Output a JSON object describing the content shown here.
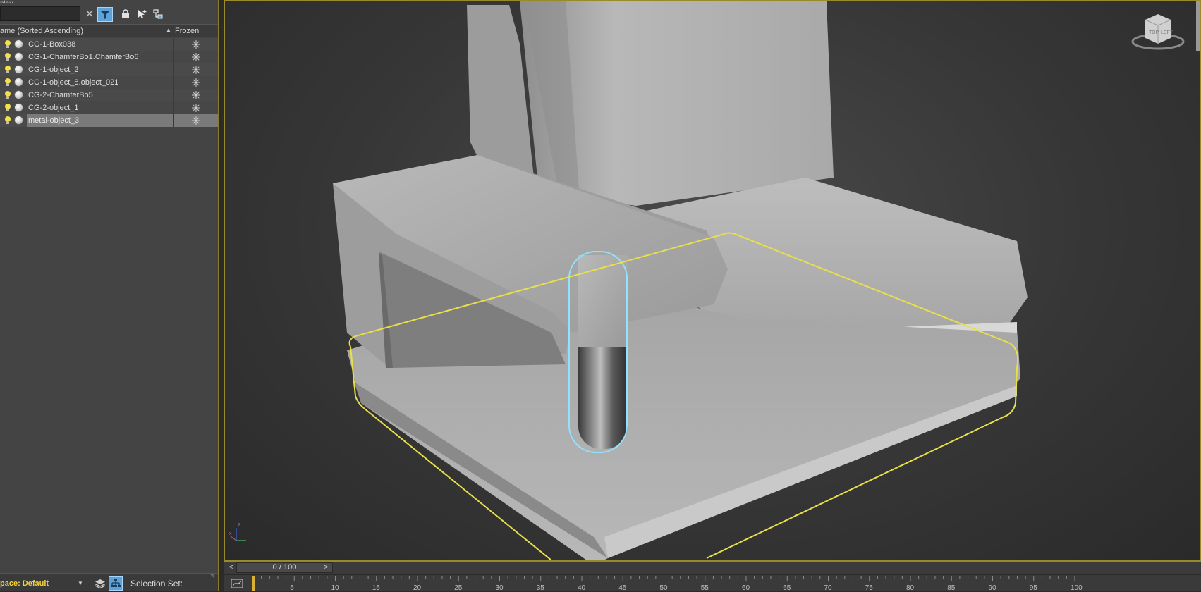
{
  "scene_explorer": {
    "title_partial": "play",
    "filter_value": "",
    "columns": {
      "name": "ame (Sorted Ascending)",
      "sort_indicator": "▲",
      "frozen": "Frozen"
    },
    "objects": [
      {
        "name": "CG-1-Box038",
        "selected": false
      },
      {
        "name": "CG-1-ChamferBo1.ChamferBo6",
        "selected": false
      },
      {
        "name": "CG-1-object_2",
        "selected": false
      },
      {
        "name": "CG-1-object_8.object_021",
        "selected": false
      },
      {
        "name": "CG-2-ChamferBo5",
        "selected": false
      },
      {
        "name": "CG-2-object_1",
        "selected": false
      },
      {
        "name": "metal-object_3",
        "selected": true
      }
    ],
    "workspace_label": "pace: Default",
    "selection_set_label": "Selection Set:"
  },
  "viewport": {
    "viewcube_faces": [
      "TOP",
      "LEFT"
    ],
    "axis_labels": {
      "x": "x",
      "y": "y",
      "z": "z"
    },
    "selection_color": "#e8e04a",
    "highlight_color": "#8fe3ff"
  },
  "timeline": {
    "prev": "<",
    "next": ">",
    "frame_display": "0 / 100",
    "ticks": [
      "5",
      "10",
      "15",
      "20",
      "25",
      "30",
      "35",
      "40",
      "45",
      "50",
      "55",
      "60",
      "65",
      "70",
      "75",
      "80",
      "85",
      "90",
      "95",
      "100"
    ]
  },
  "colors": {
    "panel_bg": "#444444",
    "active_blue": "#5da3d9",
    "viewport_border": "#9a8a2a",
    "workspace_yellow": "#f2d23a"
  }
}
